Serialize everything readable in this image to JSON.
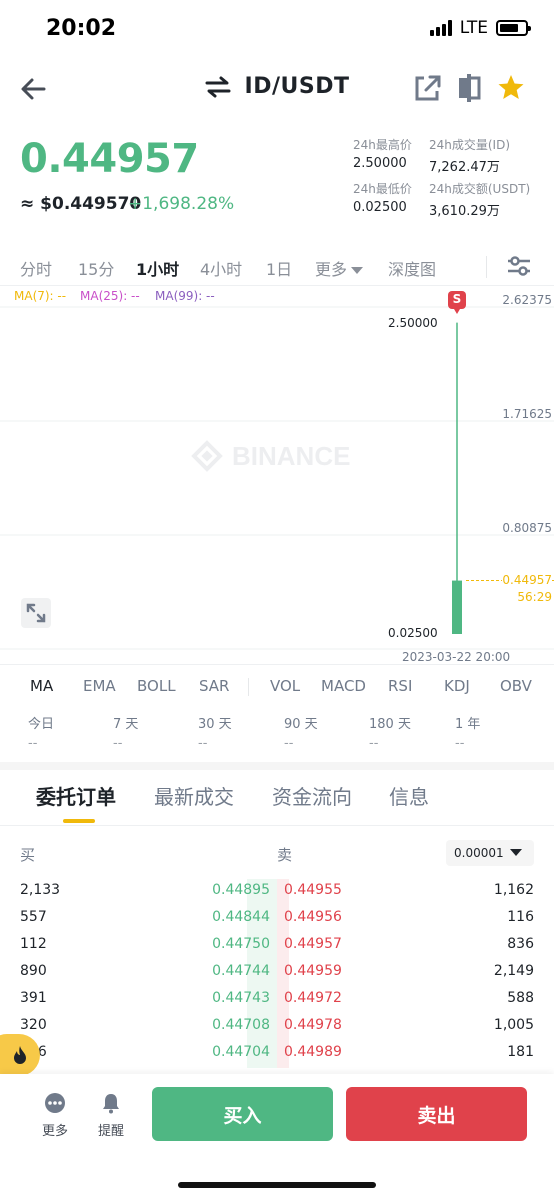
{
  "status_bar": {
    "time": "20:02",
    "network": "LTE"
  },
  "header": {
    "title": "ID/USDT"
  },
  "ticker": {
    "last_price": "0.44957",
    "fiat_price": "≈ $0.449570",
    "change_pct": "+1,698.28%",
    "stats": [
      {
        "label": "24h最高价",
        "value": "2.50000"
      },
      {
        "label": "24h成交量(ID)",
        "value": "7,262.47万"
      },
      {
        "label": "24h最低价",
        "value": "0.02500"
      },
      {
        "label": "24h成交额(USDT)",
        "value": "3,610.29万"
      }
    ]
  },
  "interval_tabs": [
    "分时",
    "15分",
    "1小时",
    "4小时",
    "1日",
    "更多",
    "深度图"
  ],
  "active_interval": "1小时",
  "chart": {
    "ma_labels": [
      {
        "text": "MA(7): --",
        "color": "#f0b90b"
      },
      {
        "text": "MA(25): --",
        "color": "#c94fc9"
      },
      {
        "text": "MA(99): --",
        "color": "#8b5fbf"
      }
    ],
    "y_axis": [
      "2.62375",
      "1.71625",
      "0.80875"
    ],
    "high_label": "2.50000",
    "low_label": "0.02500",
    "current_price": "0.44957",
    "countdown": "56:29",
    "time_label": "2023-03-22 20:00",
    "signal_badge": "S",
    "watermark": "BINANCE",
    "colors": {
      "up": "#4fb783",
      "down": "#e0424b",
      "accent": "#f0b90b"
    }
  },
  "chart_data": {
    "type": "candlestick",
    "x": [
      "2023-03-22 20:00"
    ],
    "series": [
      {
        "open": 0.025,
        "high": 2.5,
        "low": 0.025,
        "close": 0.44957
      }
    ],
    "ylim": [
      0.025,
      2.62375
    ],
    "y_ticks": [
      2.62375,
      1.71625,
      0.80875
    ]
  },
  "indicator_tabs": [
    "MA",
    "EMA",
    "BOLL",
    "SAR",
    "VOL",
    "MACD",
    "RSI",
    "KDJ",
    "OBV"
  ],
  "active_indicator": "MA",
  "performance": [
    {
      "label": "今日",
      "value": "--"
    },
    {
      "label": "7 天",
      "value": "--"
    },
    {
      "label": "30 天",
      "value": "--"
    },
    {
      "label": "90 天",
      "value": "--"
    },
    {
      "label": "180 天",
      "value": "--"
    },
    {
      "label": "1 年",
      "value": "--"
    }
  ],
  "orderbook_tabs": [
    "委托订单",
    "最新成交",
    "资金流向",
    "信息"
  ],
  "orderbook": {
    "buy_label": "买",
    "sell_label": "卖",
    "precision": "0.00001",
    "rows": [
      {
        "bid_qty": "2,133",
        "bid_price": "0.44895",
        "ask_price": "0.44955",
        "ask_qty": "1,162"
      },
      {
        "bid_qty": "557",
        "bid_price": "0.44844",
        "ask_price": "0.44956",
        "ask_qty": "116"
      },
      {
        "bid_qty": "112",
        "bid_price": "0.44750",
        "ask_price": "0.44957",
        "ask_qty": "836"
      },
      {
        "bid_qty": "890",
        "bid_price": "0.44744",
        "ask_price": "0.44959",
        "ask_qty": "2,149"
      },
      {
        "bid_qty": "391",
        "bid_price": "0.44743",
        "ask_price": "0.44972",
        "ask_qty": "588"
      },
      {
        "bid_qty": "320",
        "bid_price": "0.44708",
        "ask_price": "0.44978",
        "ask_qty": "1,005"
      },
      {
        "bid_qty": "366",
        "bid_price": "0.44704",
        "ask_price": "0.44989",
        "ask_qty": "181"
      }
    ]
  },
  "bottom_bar": {
    "more_label": "更多",
    "alert_label": "提醒",
    "buy_label": "买入",
    "sell_label": "卖出"
  }
}
